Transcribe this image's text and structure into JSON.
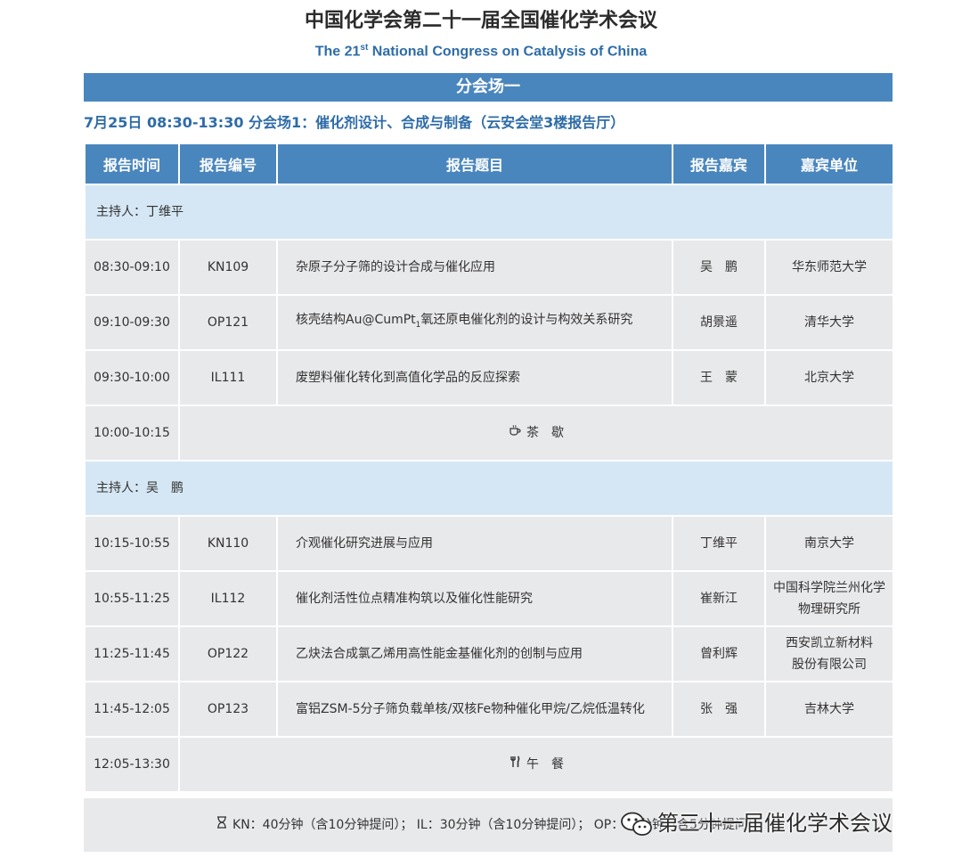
{
  "header": {
    "title_cn": "中国化学会第二十一届全国催化学术会议",
    "title_en_prefix": "The 21",
    "title_en_sup": "st",
    "title_en_suffix": " National Congress on Catalysis of China"
  },
  "venue": "分会场一",
  "session": "7月25日  08:30-13:30  分会场1：催化剂设计、合成与制备（云安会堂3楼报告厅）",
  "columns": [
    "报告时间",
    "报告编号",
    "报告题目",
    "报告嘉宾",
    "嘉宾单位"
  ],
  "hosts": {
    "first": "主持人：丁维平",
    "second": "主持人：吴　鹏"
  },
  "talks": [
    {
      "time": "08:30-09:10",
      "code": "KN109",
      "title": "杂原子分子筛的设计合成与催化应用",
      "speaker": "吴　鹏",
      "affiliation": "华东师范大学"
    },
    {
      "time": "09:10-09:30",
      "code": "OP121",
      "title_pre": "核壳结构Au@CumPt",
      "title_sub": "1",
      "title_post": "氧还原电催化剂的设计与构效关系研究",
      "speaker": "胡景遥",
      "affiliation": "清华大学"
    },
    {
      "time": "09:30-10:00",
      "code": "IL111",
      "title": "废塑料催化转化到高值化学品的反应探索",
      "speaker": "王　蒙",
      "affiliation": "北京大学"
    },
    {
      "time": "10:15-10:55",
      "code": "KN110",
      "title": "介观催化研究进展与应用",
      "speaker": "丁维平",
      "affiliation": "南京大学"
    },
    {
      "time": "10:55-11:25",
      "code": "IL112",
      "title": "催化剂活性位点精准构筑以及催化性能研究",
      "speaker": "崔新江",
      "affiliation_line1": "中国科学院兰州化学",
      "affiliation_line2": "物理研究所"
    },
    {
      "time": "11:25-11:45",
      "code": "OP122",
      "title": "乙炔法合成氯乙烯用高性能金基催化剂的创制与应用",
      "speaker": "曾利辉",
      "affiliation_line1": "西安凯立新材料",
      "affiliation_line2": "股份有限公司"
    },
    {
      "time": "11:45-12:05",
      "code": "OP123",
      "title": "富铝ZSM-5分子筛负载单核/双核Fe物种催化甲烷/乙烷低温转化",
      "speaker": "张　强",
      "affiliation": "吉林大学"
    }
  ],
  "breaks": {
    "tea": {
      "time": "10:00-10:15",
      "label": "茶　歇",
      "icon": "tea-cup-icon"
    },
    "lunch": {
      "time": "12:05-13:30",
      "label": "午　餐",
      "icon": "fork-knife-icon"
    }
  },
  "footer": {
    "icon": "hourglass-icon",
    "text": "KN：40分钟（含10分钟提问）；  IL：30分钟（含10分钟提问）；  OP：20分钟（含5分钟提问）"
  },
  "watermark": {
    "icon": "wechat-icon",
    "text": "第三十一届催化学术会议"
  },
  "colors": {
    "header_blue": "#4a86be",
    "title_blue": "#2e6ca8",
    "host_row": "#d5e7f4",
    "cell_gray": "#e8e9eb"
  }
}
